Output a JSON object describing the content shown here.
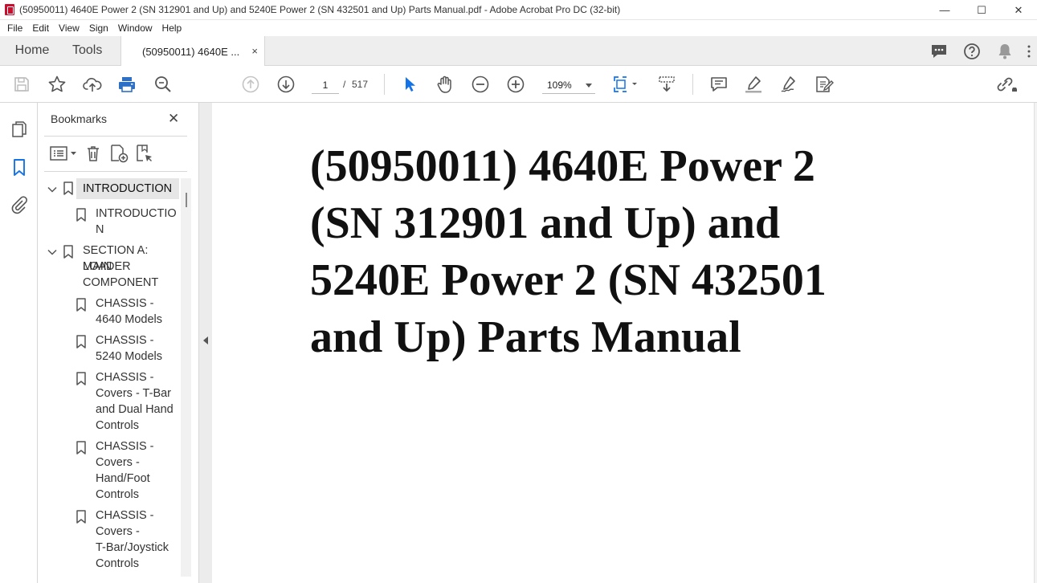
{
  "window": {
    "title": "(50950011) 4640E Power 2 (SN 312901 and Up) and 5240E Power 2 (SN 432501 and Up) Parts Manual.pdf - Adobe Acrobat Pro DC (32-bit)",
    "minimize": "—",
    "maximize": "☐",
    "close": "✕"
  },
  "menu": [
    "File",
    "Edit",
    "View",
    "Sign",
    "Window",
    "Help"
  ],
  "tabs": {
    "home": "Home",
    "tools": "Tools",
    "document": "(50950011) 4640E ...",
    "document_close": "×"
  },
  "toolbar": {
    "current_page": "1",
    "page_separator": "/",
    "total_pages": "517",
    "zoom": "109%"
  },
  "bookmarks": {
    "title": "Bookmarks",
    "close": "✕",
    "items": [
      {
        "label_lines": [
          "INTRODUCTION"
        ],
        "level": 0,
        "expanded": true,
        "selected": true
      },
      {
        "label_lines": [
          "INTRODUCTIO",
          "N"
        ],
        "level": 1
      },
      {
        "label_lines": [
          "SECTION A: MAIN",
          "LOADER",
          "COMPONENT"
        ],
        "level": 0,
        "expanded": true
      },
      {
        "label_lines": [
          "CHASSIS -",
          "4640 Models"
        ],
        "level": 1
      },
      {
        "label_lines": [
          "CHASSIS -",
          "5240 Models"
        ],
        "level": 1
      },
      {
        "label_lines": [
          "CHASSIS -",
          "Covers - T-Bar",
          "and Dual Hand",
          "Controls"
        ],
        "level": 1
      },
      {
        "label_lines": [
          "CHASSIS -",
          "Covers -",
          "Hand/Foot",
          "Controls"
        ],
        "level": 1
      },
      {
        "label_lines": [
          "CHASSIS -",
          "Covers -",
          "T-Bar/Joystick",
          "Controls"
        ],
        "level": 1
      }
    ]
  },
  "document": {
    "title_lines": [
      "(50950011) 4640E Power 2",
      "(SN 312901 and Up) and",
      "5240E Power 2 (SN 432501",
      "and Up) Parts Manual"
    ]
  },
  "colors": {
    "accent_blue": "#1473e6",
    "print_blue": "#2d70c6",
    "acrobat_red": "#c8102e"
  }
}
